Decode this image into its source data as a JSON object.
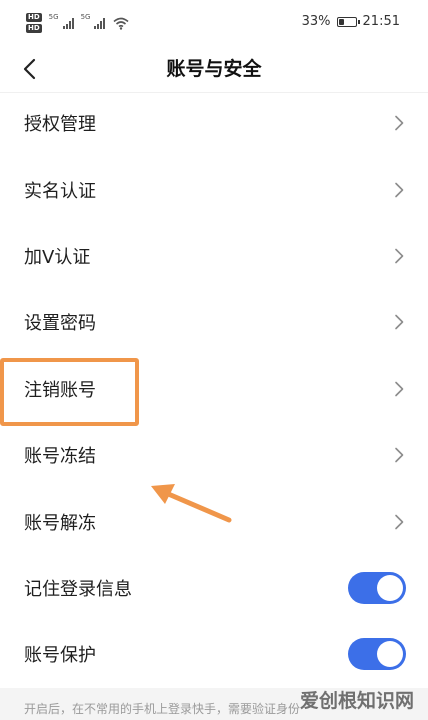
{
  "status_bar": {
    "hd1": "HD",
    "hd2": "HD",
    "net1": "5G",
    "net2": "5G",
    "battery_percent": "33%",
    "battery_level": 0.33,
    "time": "21:51"
  },
  "nav": {
    "title": "账号与安全"
  },
  "menu": {
    "items": [
      {
        "label": "授权管理"
      },
      {
        "label": "实名认证"
      },
      {
        "label": "加V认证"
      },
      {
        "label": "设置密码"
      },
      {
        "label": "注销账号"
      },
      {
        "label": "账号冻结"
      },
      {
        "label": "账号解冻"
      }
    ],
    "toggles": [
      {
        "label": "记住登录信息",
        "on": true
      },
      {
        "label": "账号保护",
        "on": true
      }
    ]
  },
  "footer": {
    "note": "开启后，在不常用的手机上登录快手，需要验证身份"
  },
  "watermark": {
    "text": "爱创根知识网"
  },
  "colors": {
    "toggle_on": "#3c6fe8",
    "highlight": "#f0964a"
  }
}
